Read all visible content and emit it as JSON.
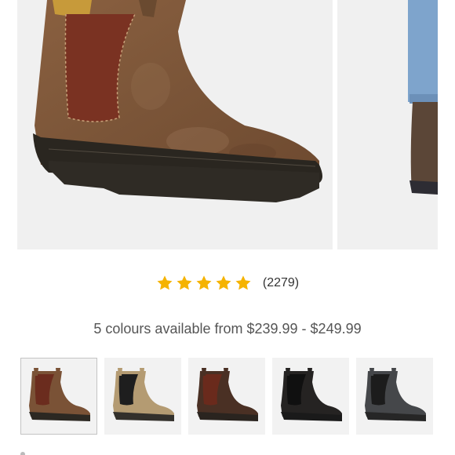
{
  "gallery": {
    "images": [
      {
        "alt": "Chelsea boot in rustic brown leather, side view"
      },
      {
        "alt": "Boot worn with blue jeans"
      }
    ]
  },
  "rating": {
    "stars": 5,
    "review_count": "(2279)",
    "star_color": "#f5b301"
  },
  "colours": {
    "summary": "5 colours available from $239.99 - $249.99",
    "swatches": [
      {
        "name": "rustic-brown",
        "leather": "#7a5236",
        "gore": "#6b2c1e",
        "sole": "#2c2822",
        "selected": true
      },
      {
        "name": "saddle-tan",
        "leather": "#b49b72",
        "gore": "#1e1e1e",
        "sole": "#33302b",
        "selected": false
      },
      {
        "name": "walnut-brown",
        "leather": "#4a3024",
        "gore": "#6a2a1c",
        "sole": "#2a241f",
        "selected": false
      },
      {
        "name": "black",
        "leather": "#252322",
        "gore": "#101010",
        "sole": "#1a1a1a",
        "selected": false
      },
      {
        "name": "rustic-black",
        "leather": "#45474a",
        "gore": "#1c1c1c",
        "sole": "#262626",
        "selected": false
      }
    ]
  }
}
